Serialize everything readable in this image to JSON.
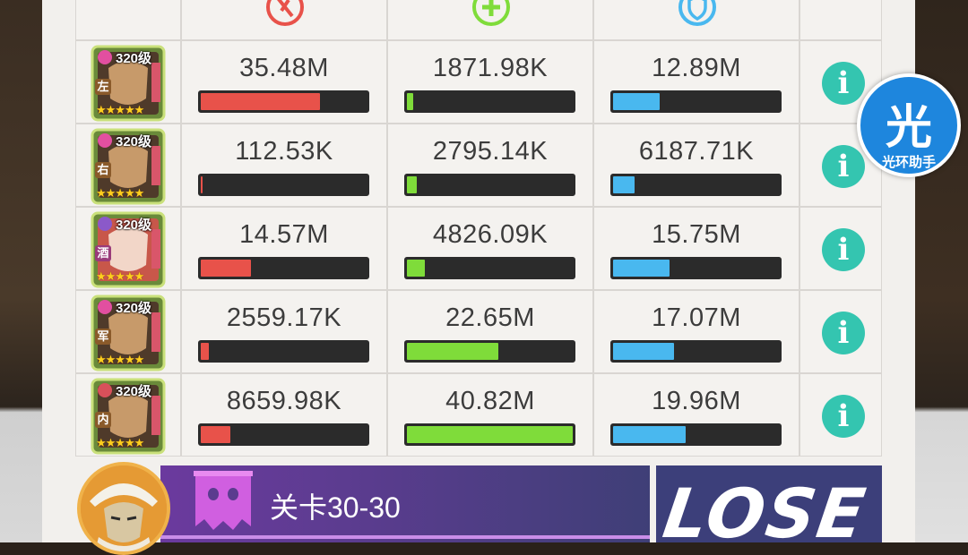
{
  "colors": {
    "damage": "#e8524a",
    "heal": "#7fdc3a",
    "defense": "#49b8ef",
    "info": "#34c5b0"
  },
  "header_icons": [
    "damage-icon",
    "heal-cross-icon",
    "shield-icon"
  ],
  "rows": [
    {
      "level": "320级",
      "tag": "左",
      "tag_color": "#8a5a2a",
      "damage": "35.48M",
      "damage_pct": 0.72,
      "heal": "1871.98K",
      "heal_pct": 0.04,
      "defense": "12.89M",
      "defense_pct": 0.28,
      "stars": "★★★★★"
    },
    {
      "level": "320级",
      "tag": "右",
      "tag_color": "#8a5a2a",
      "damage": "112.53K",
      "damage_pct": 0.01,
      "heal": "2795.14K",
      "heal_pct": 0.06,
      "defense": "6187.71K",
      "defense_pct": 0.13,
      "stars": "★★★★★"
    },
    {
      "level": "320级",
      "tag": "酒",
      "tag_color": "#9a3b7a",
      "damage": "14.57M",
      "damage_pct": 0.3,
      "heal": "4826.09K",
      "heal_pct": 0.11,
      "defense": "15.75M",
      "defense_pct": 0.34,
      "stars": "★★★★★"
    },
    {
      "level": "320级",
      "tag": "军",
      "tag_color": "#8a5a2a",
      "damage": "2559.17K",
      "damage_pct": 0.05,
      "heal": "22.65M",
      "heal_pct": 0.55,
      "defense": "17.07M",
      "defense_pct": 0.37,
      "stars": "★★★★★"
    },
    {
      "level": "320级",
      "tag": "内",
      "tag_color": "#8a5a2a",
      "damage": "8659.98K",
      "damage_pct": 0.18,
      "heal": "40.82M",
      "heal_pct": 1.0,
      "defense": "19.96M",
      "defense_pct": 0.44,
      "stars": "★★★★★"
    }
  ],
  "info_glyph": "i",
  "badge": {
    "big": "光",
    "small": "光环助手"
  },
  "stage": {
    "label": "关卡30-30"
  },
  "result": {
    "label": "LOSE"
  }
}
